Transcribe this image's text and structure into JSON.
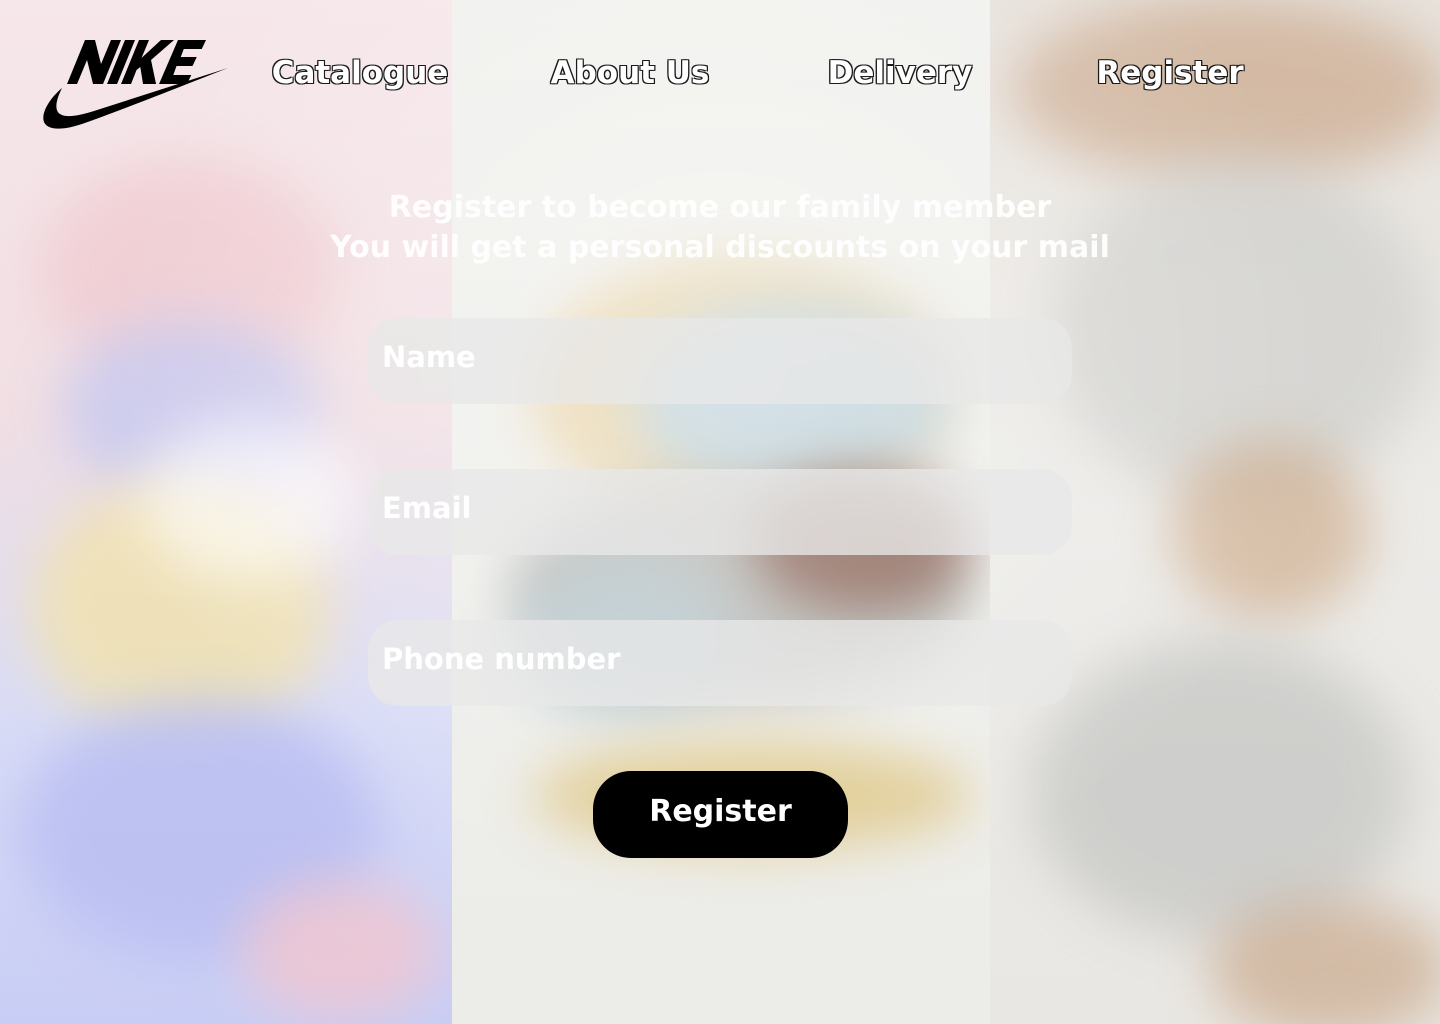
{
  "brand": {
    "logo_text": "NIKE",
    "logo_icon": "nike-swoosh-icon",
    "color": "#000000"
  },
  "nav": {
    "items": [
      {
        "label": "Catalogue"
      },
      {
        "label": "About Us"
      },
      {
        "label": "Delivery"
      },
      {
        "label": "Register"
      }
    ]
  },
  "heading": {
    "line1": "Register to become our family member",
    "line2": "You will get a personal discounts on your mail"
  },
  "form": {
    "name": {
      "placeholder": "Name",
      "value": ""
    },
    "email": {
      "placeholder": "Email",
      "value": ""
    },
    "phone": {
      "placeholder": "Phone number",
      "value": ""
    },
    "submit_label": "Register"
  },
  "colors": {
    "button_bg": "#000000",
    "button_text": "#ffffff",
    "field_bg": "#e8e8e8",
    "text_light": "#ffffff"
  }
}
